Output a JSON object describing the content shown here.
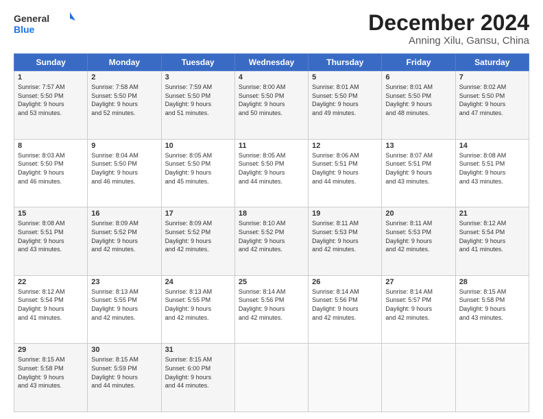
{
  "logo": {
    "line1": "General",
    "line2": "Blue"
  },
  "header": {
    "month": "December 2024",
    "location": "Anning Xilu, Gansu, China"
  },
  "weekdays": [
    "Sunday",
    "Monday",
    "Tuesday",
    "Wednesday",
    "Thursday",
    "Friday",
    "Saturday"
  ],
  "weeks": [
    [
      {
        "day": "1",
        "info": "Sunrise: 7:57 AM\nSunset: 5:50 PM\nDaylight: 9 hours\nand 53 minutes."
      },
      {
        "day": "2",
        "info": "Sunrise: 7:58 AM\nSunset: 5:50 PM\nDaylight: 9 hours\nand 52 minutes."
      },
      {
        "day": "3",
        "info": "Sunrise: 7:59 AM\nSunset: 5:50 PM\nDaylight: 9 hours\nand 51 minutes."
      },
      {
        "day": "4",
        "info": "Sunrise: 8:00 AM\nSunset: 5:50 PM\nDaylight: 9 hours\nand 50 minutes."
      },
      {
        "day": "5",
        "info": "Sunrise: 8:01 AM\nSunset: 5:50 PM\nDaylight: 9 hours\nand 49 minutes."
      },
      {
        "day": "6",
        "info": "Sunrise: 8:01 AM\nSunset: 5:50 PM\nDaylight: 9 hours\nand 48 minutes."
      },
      {
        "day": "7",
        "info": "Sunrise: 8:02 AM\nSunset: 5:50 PM\nDaylight: 9 hours\nand 47 minutes."
      }
    ],
    [
      {
        "day": "8",
        "info": "Sunrise: 8:03 AM\nSunset: 5:50 PM\nDaylight: 9 hours\nand 46 minutes."
      },
      {
        "day": "9",
        "info": "Sunrise: 8:04 AM\nSunset: 5:50 PM\nDaylight: 9 hours\nand 46 minutes."
      },
      {
        "day": "10",
        "info": "Sunrise: 8:05 AM\nSunset: 5:50 PM\nDaylight: 9 hours\nand 45 minutes."
      },
      {
        "day": "11",
        "info": "Sunrise: 8:05 AM\nSunset: 5:50 PM\nDaylight: 9 hours\nand 44 minutes."
      },
      {
        "day": "12",
        "info": "Sunrise: 8:06 AM\nSunset: 5:51 PM\nDaylight: 9 hours\nand 44 minutes."
      },
      {
        "day": "13",
        "info": "Sunrise: 8:07 AM\nSunset: 5:51 PM\nDaylight: 9 hours\nand 43 minutes."
      },
      {
        "day": "14",
        "info": "Sunrise: 8:08 AM\nSunset: 5:51 PM\nDaylight: 9 hours\nand 43 minutes."
      }
    ],
    [
      {
        "day": "15",
        "info": "Sunrise: 8:08 AM\nSunset: 5:51 PM\nDaylight: 9 hours\nand 43 minutes."
      },
      {
        "day": "16",
        "info": "Sunrise: 8:09 AM\nSunset: 5:52 PM\nDaylight: 9 hours\nand 42 minutes."
      },
      {
        "day": "17",
        "info": "Sunrise: 8:09 AM\nSunset: 5:52 PM\nDaylight: 9 hours\nand 42 minutes."
      },
      {
        "day": "18",
        "info": "Sunrise: 8:10 AM\nSunset: 5:52 PM\nDaylight: 9 hours\nand 42 minutes."
      },
      {
        "day": "19",
        "info": "Sunrise: 8:11 AM\nSunset: 5:53 PM\nDaylight: 9 hours\nand 42 minutes."
      },
      {
        "day": "20",
        "info": "Sunrise: 8:11 AM\nSunset: 5:53 PM\nDaylight: 9 hours\nand 42 minutes."
      },
      {
        "day": "21",
        "info": "Sunrise: 8:12 AM\nSunset: 5:54 PM\nDaylight: 9 hours\nand 41 minutes."
      }
    ],
    [
      {
        "day": "22",
        "info": "Sunrise: 8:12 AM\nSunset: 5:54 PM\nDaylight: 9 hours\nand 41 minutes."
      },
      {
        "day": "23",
        "info": "Sunrise: 8:13 AM\nSunset: 5:55 PM\nDaylight: 9 hours\nand 42 minutes."
      },
      {
        "day": "24",
        "info": "Sunrise: 8:13 AM\nSunset: 5:55 PM\nDaylight: 9 hours\nand 42 minutes."
      },
      {
        "day": "25",
        "info": "Sunrise: 8:14 AM\nSunset: 5:56 PM\nDaylight: 9 hours\nand 42 minutes."
      },
      {
        "day": "26",
        "info": "Sunrise: 8:14 AM\nSunset: 5:56 PM\nDaylight: 9 hours\nand 42 minutes."
      },
      {
        "day": "27",
        "info": "Sunrise: 8:14 AM\nSunset: 5:57 PM\nDaylight: 9 hours\nand 42 minutes."
      },
      {
        "day": "28",
        "info": "Sunrise: 8:15 AM\nSunset: 5:58 PM\nDaylight: 9 hours\nand 43 minutes."
      }
    ],
    [
      {
        "day": "29",
        "info": "Sunrise: 8:15 AM\nSunset: 5:58 PM\nDaylight: 9 hours\nand 43 minutes."
      },
      {
        "day": "30",
        "info": "Sunrise: 8:15 AM\nSunset: 5:59 PM\nDaylight: 9 hours\nand 44 minutes."
      },
      {
        "day": "31",
        "info": "Sunrise: 8:15 AM\nSunset: 6:00 PM\nDaylight: 9 hours\nand 44 minutes."
      },
      {
        "day": "",
        "info": ""
      },
      {
        "day": "",
        "info": ""
      },
      {
        "day": "",
        "info": ""
      },
      {
        "day": "",
        "info": ""
      }
    ]
  ]
}
